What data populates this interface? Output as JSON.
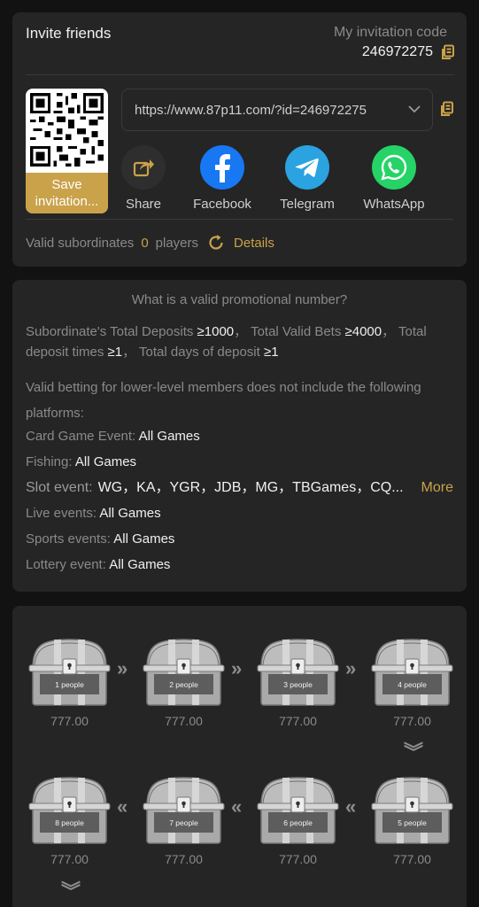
{
  "invite": {
    "title": "Invite friends",
    "code_label": "My invitation code",
    "code_value": "246972275",
    "save_label": "Save invitation...",
    "link": "https://www.87p11.com/?id=246972275",
    "share_items": [
      {
        "label": "Share",
        "icon": "share-icon",
        "color": "#2e2e2e"
      },
      {
        "label": "Facebook",
        "icon": "facebook-icon",
        "color": "#1877f2"
      },
      {
        "label": "Telegram",
        "icon": "telegram-icon",
        "color": "#2aa3e0"
      },
      {
        "label": "WhatsApp",
        "icon": "whatsapp-icon",
        "color": "#25d366"
      }
    ],
    "valid_label": "Valid subordinates",
    "valid_count": "0",
    "valid_unit": "players",
    "details_label": "Details"
  },
  "promo": {
    "title": "What is a valid promotional number?",
    "conditions": {
      "deposits_label": "Subordinate's Total Deposits",
      "deposits_value": "≥1000",
      "bets_label": "Total Valid Bets",
      "bets_value": "≥4000",
      "times_label": "Total deposit times",
      "times_value": "≥1",
      "days_label": "Total days of deposit",
      "days_value": "≥1"
    },
    "exclusion_note": "Valid betting for lower-level members does not include the following platforms:",
    "events": [
      {
        "label": "Card Game Event:",
        "value": "All Games"
      },
      {
        "label": "Fishing:",
        "value": "All Games"
      },
      {
        "label": "Slot event:",
        "value": "WG，KA，YGR，JDB，MG，TBGames，CQ..."
      },
      {
        "label": "Live events:",
        "value": "All Games"
      },
      {
        "label": "Sports events:",
        "value": "All Games"
      },
      {
        "label": "Lottery event:",
        "value": "All Games"
      }
    ],
    "more_label": "More"
  },
  "chests": [
    {
      "label": "1 people",
      "amount": "777.00"
    },
    {
      "label": "2 people",
      "amount": "777.00"
    },
    {
      "label": "3 people",
      "amount": "777.00"
    },
    {
      "label": "4 people",
      "amount": "777.00"
    },
    {
      "label": "5 people",
      "amount": "777.00"
    },
    {
      "label": "6 people",
      "amount": "777.00"
    },
    {
      "label": "7 people",
      "amount": "777.00"
    },
    {
      "label": "8 people",
      "amount": "777.00"
    }
  ],
  "colors": {
    "accent": "#c9a24a",
    "background": "#121212",
    "card": "#252525"
  }
}
